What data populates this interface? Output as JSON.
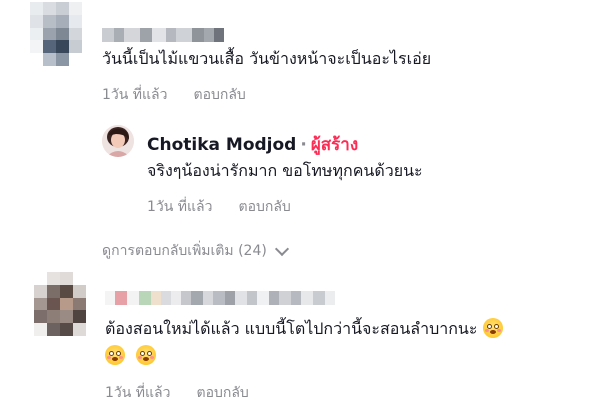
{
  "comments": [
    {
      "author_name": "",
      "text": "วันนี้เป็นไม้แขวนเสื้อ วันข้างหน้าจะเป็นอะไรเอ่ย",
      "time": "1วัน ที่แล้ว",
      "reply_label": "ตอบกลับ"
    },
    {
      "author_name": "Chotika Modjod",
      "author_badge": "ผู้สร้าง",
      "separator": "·",
      "text": "จริงๆน้องน่ารักมาก ขอโทษทุกคนด้วยนะ",
      "time": "1วัน ที่แล้ว",
      "reply_label": "ตอบกลับ"
    },
    {
      "more_replies_label": "ดูการตอบกลับเพิ่มเติม (24)"
    },
    {
      "author_name": "",
      "text": "ต้องสอนใหม่ได้แล้ว แบบนี้โตไปกว่านี้จะสอนลำบากนะ",
      "emoji_name": "flushed-face",
      "time": "1วัน ที่แล้ว",
      "reply_label": "ตอบกลับ"
    }
  ],
  "colors": {
    "creator_badge": "#fe2c55",
    "meta_text": "#8a8b91",
    "body_text": "#161823"
  }
}
